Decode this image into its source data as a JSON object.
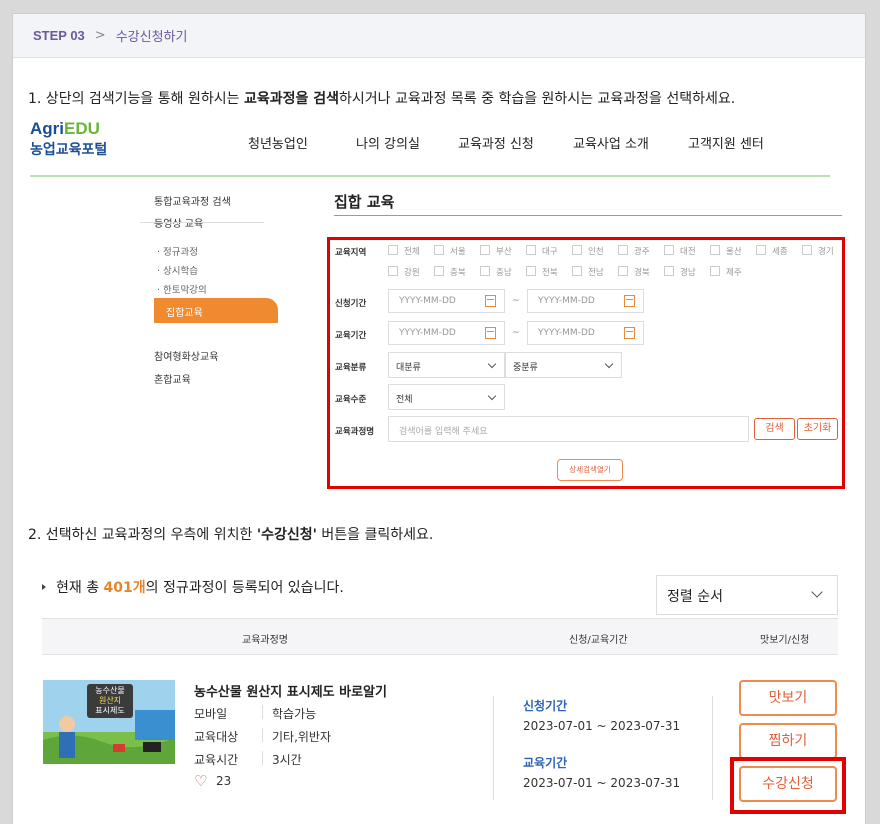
{
  "step": {
    "number": "STEP 03",
    "separator": ">",
    "title": "수강신청하기"
  },
  "instruction1": {
    "prefix": "1. 상단의 검색기능을 통해 원하시는 ",
    "bold": "교육과정을 검색",
    "suffix": "하시거나 교육과정 목록 중 학습을 원하시는 교육과정을 선택하세요."
  },
  "logo": {
    "agri": "Agri",
    "edu": "EDU",
    "sub": "농업교육포털"
  },
  "topnav": [
    "청년농업인",
    "나의 강의실",
    "교육과정 신청",
    "교육사업 소개",
    "고객지원 센터"
  ],
  "leftnav": {
    "items": [
      "통합교육과정 검색",
      "동영상 교육"
    ],
    "subitems": [
      "· 정규과정",
      "· 상시학습",
      "· 한토막강의"
    ],
    "active": "집합교육",
    "bottom": [
      "참여형화상교육",
      "혼합교육"
    ]
  },
  "section_title": "집합 교육",
  "search": {
    "region_label": "교육지역",
    "regions_row1": [
      "전체",
      "서울",
      "부산",
      "대구",
      "인천",
      "광주",
      "대전",
      "울산",
      "세종",
      "경기"
    ],
    "regions_row2": [
      "강원",
      "충북",
      "충남",
      "전북",
      "전남",
      "경북",
      "경남",
      "제주"
    ],
    "apply_label": "신청기간",
    "edu_period_label": "교육기간",
    "date_placeholder": "YYYY-MM-DD",
    "tilde": "~",
    "category_label": "교육분류",
    "category_major": "대분류",
    "category_minor": "중분류",
    "level_label": "교육수준",
    "level_value": "전체",
    "name_label": "교육과정명",
    "name_placeholder": "검색어를 입력해 주세요",
    "search_btn": "검색",
    "reset_btn": "초기화",
    "detail_btn": "상세검색열기"
  },
  "instruction2": {
    "prefix": "2. 선택하신 교육과정의 우측에 위치한 ",
    "bold": "'수강신청'",
    "suffix": " 버튼을 클릭하세요."
  },
  "list": {
    "count_prefix": "현재 총 ",
    "count": "401개",
    "count_suffix": "의 정규과정이 등록되어 있습니다.",
    "sort_label": "정렬 순서"
  },
  "table_headers": [
    "교육과정명",
    "신청/교육기간",
    "맛보기/신청"
  ],
  "course": {
    "thumbnail_text": [
      "농수산물",
      "원산지",
      "표시제도"
    ],
    "title": "농수산물 원산지 표시제도 바로알기",
    "device": "모바일",
    "device_value": "학습가능",
    "target_label": "교육대상",
    "target_value": "기타,위반자",
    "time_label": "교육시간",
    "time_value": "3시간",
    "likes": "23",
    "apply_label": "신청기간",
    "apply_dates": "2023-07-01 ~ 2023-07-31",
    "edu_label": "교육기간",
    "edu_dates": "2023-07-01 ~ 2023-07-31",
    "preview_btn": "맛보기",
    "wish_btn": "찜하기",
    "enroll_btn": "수강신청"
  },
  "colors": {
    "accent": "#ef8a30",
    "highlight": "#e30000",
    "link_blue": "#2e63b8",
    "step_purple": "#6a5a9e"
  }
}
